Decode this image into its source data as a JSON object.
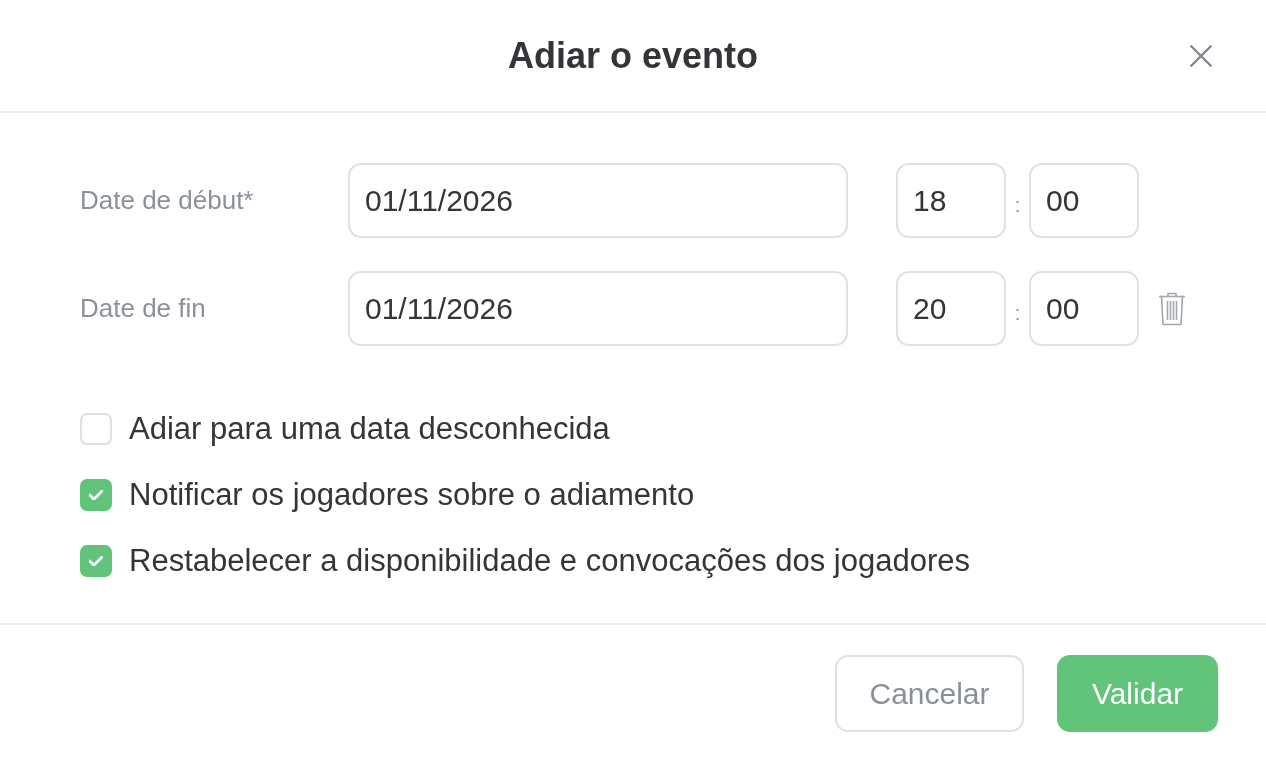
{
  "dialog": {
    "title": "Adiar o evento"
  },
  "date_rows": [
    {
      "label": "Date de début*",
      "date": "01/11/2026",
      "hour": "18",
      "separator": ":",
      "minute": "00",
      "deletable": false
    },
    {
      "label": "Date de fin",
      "date": "01/11/2026",
      "hour": "20",
      "separator": ":",
      "minute": "00",
      "deletable": true
    }
  ],
  "options": [
    {
      "label": "Adiar para uma data desconhecida",
      "checked": false
    },
    {
      "label": "Notificar os jogadores sobre o adiamento",
      "checked": true
    },
    {
      "label": "Restabelecer a disponibilidade e convocações dos jogadores",
      "checked": true
    }
  ],
  "buttons": [
    {
      "label": "Cancelar",
      "kind": "secondary"
    },
    {
      "label": "Validar",
      "kind": "primary"
    }
  ]
}
